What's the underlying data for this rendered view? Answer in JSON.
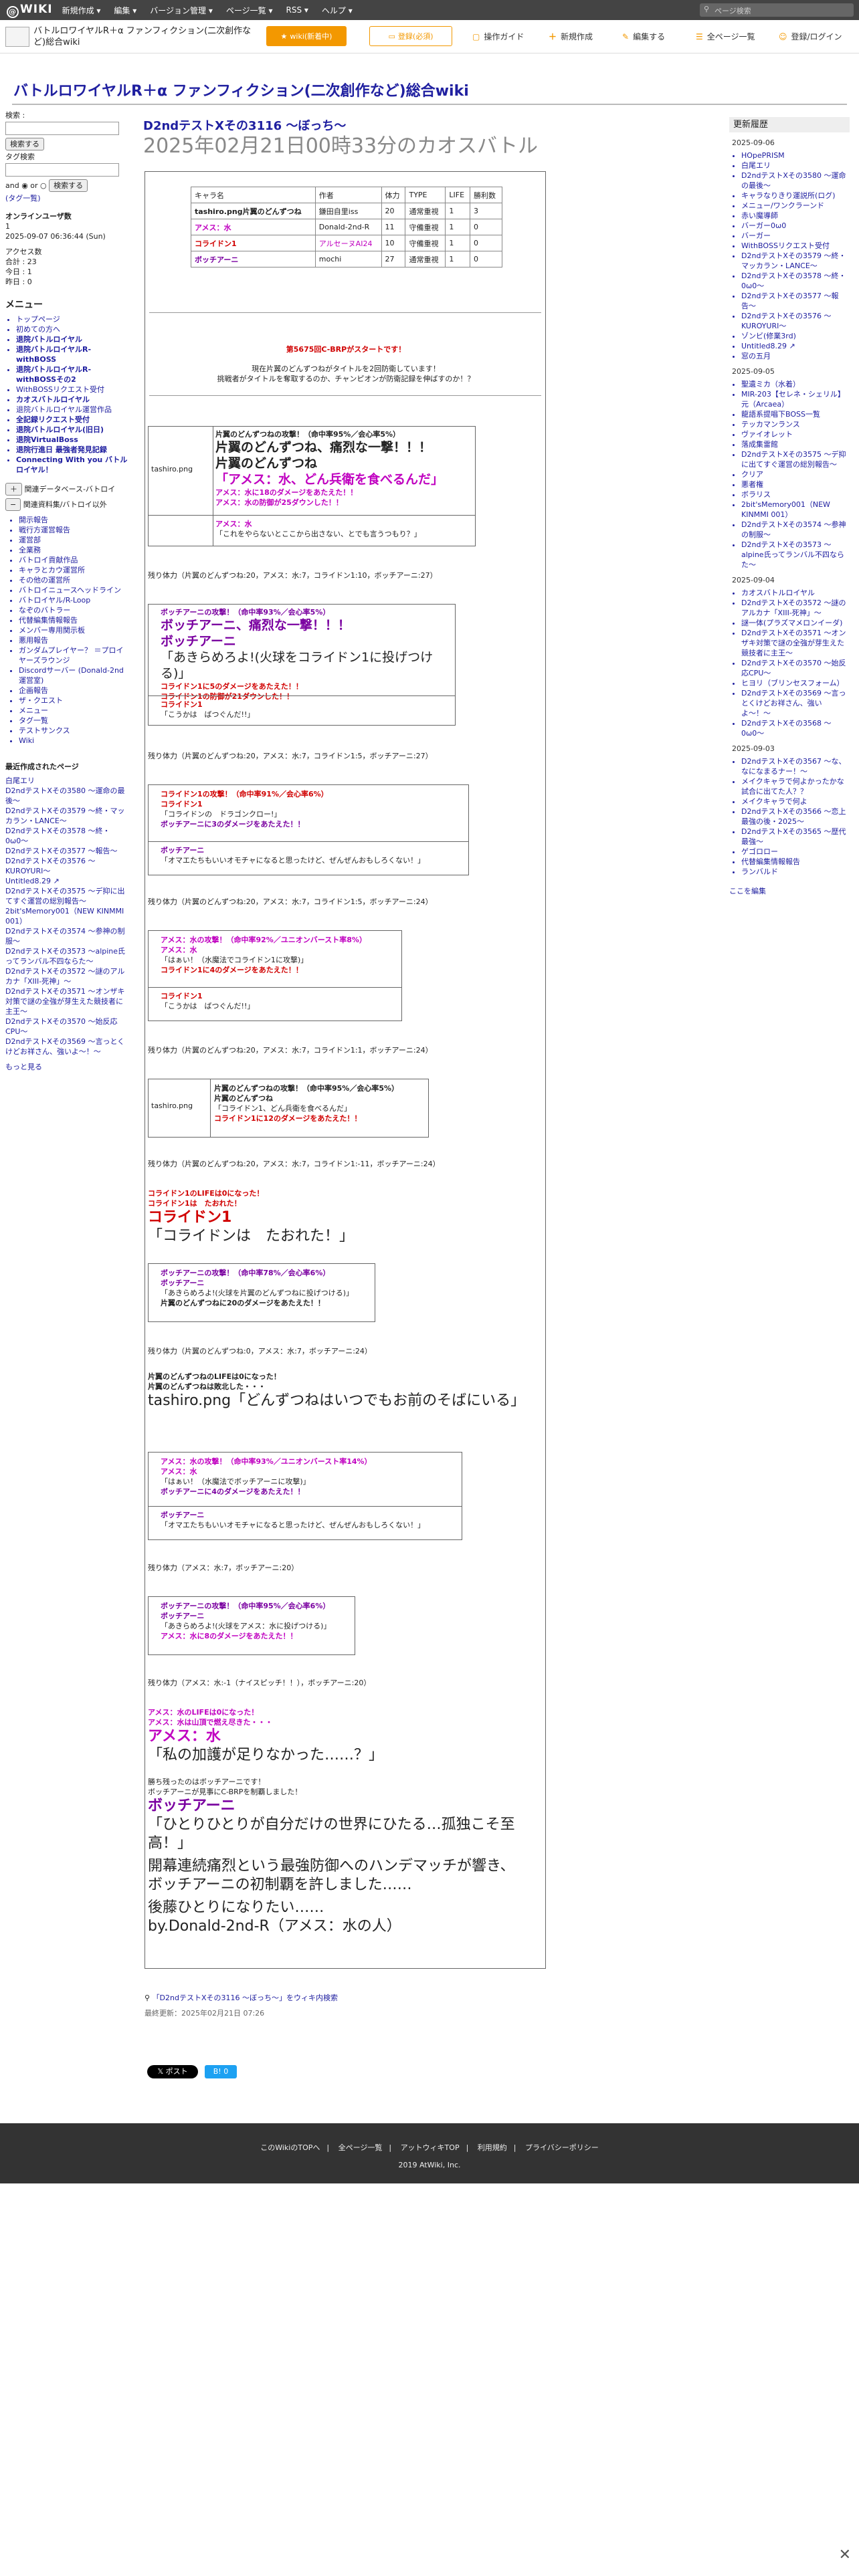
{
  "topbar": {
    "logo": "WIKI",
    "menus": [
      "新規作成 ▾",
      "編集 ▾",
      "バージョン管理 ▾",
      "ページ一覧 ▾",
      "RSS ▾",
      "ヘルプ ▾"
    ],
    "search_placeholder": "ページ検索"
  },
  "sitebar": {
    "title": "バトルロワイヤルR＋α ファンフィクション(二次創作など)総合wiki",
    "btn_wiki": "wiki(新着中)",
    "btn_register": "登録(必須)",
    "nav": [
      "操作ガイド",
      "新規作成",
      "編集する",
      "全ページ一覧",
      "登録/ログイン"
    ]
  },
  "h1": "バトルロワイヤルR＋α ファンフィクション(二次創作など)総合wiki",
  "left": {
    "search_label": "検索 :",
    "search_btn": "検索する",
    "tag_label": "タグ検索",
    "and_label": "and",
    "or_label": "or",
    "search_btn2": "検索する",
    "tag_list": "(タグ一覧)",
    "online_label": "オンラインユーザ数",
    "online_count": "1",
    "date": "2025-09-07 06:36:44 (Sun)",
    "access_label": "アクセス数",
    "access_total": "合計 : 23",
    "access_today": "今日 : 1",
    "access_yesterday": "昨日 : 0",
    "menu_head": "メニュー",
    "menu": [
      "トップページ",
      "初めての方へ",
      "退院バトルロイヤル",
      "退院バトルロイヤルR-withBOSS",
      "退院バトルロイヤルR-withBOSSその2",
      "WithBOSSリクエスト受付",
      "カオスバトルロイヤル",
      "退院バトルロイヤル運営作品",
      "全記録リクエスト受付",
      "退院バトルロイヤル(旧日)",
      "退院VirtualBoss",
      "退院行進日 最強者発見記録",
      "Connecting With you バトルロイヤル！"
    ],
    "tree": [
      "関連データベース-バトロイ",
      "関連資料集/バトロイ以外",
      "開示報告",
      "戦行方運営報告",
      "運営部",
      "全業務",
      "バトロイ貢献作品",
      "キャラとカウ運営所",
      "その他の運営所",
      "バトロイニュースヘッドライン",
      "バトロイヤル/R-Loop",
      "なぞのバトラー",
      "代替編集情報報告",
      "メンバー専用関示板",
      "悪用報告",
      "ガンダムプレイヤー？ ＝プロイヤーズラウンジ",
      "Discordサーバー (Donald-2nd運営室)",
      "企画報告",
      "ザ・クエスト",
      "メニュー",
      "タグ一覧",
      "テストサンクス",
      "Wiki"
    ],
    "recent_head": "最近作成されたページ",
    "recent": [
      "白尾エリ",
      "D2ndテストXその3580 〜運命の最後〜",
      "D2ndテストXその3579 〜終・マッカラン・LANCE〜",
      "D2ndテストXその3578 〜終・0ω0〜",
      "D2ndテストXその3577 〜報告〜",
      "D2ndテストXその3576 〜KUROYURI〜",
      "Untitled8.29 ↗",
      "D2ndテストXその3575 〜デ抑に出てすぐ運営の総別報告〜",
      "2bit'sMemory001（NEW KINMMI 001）",
      "D2ndテストXその3574 〜参神の制服〜",
      "D2ndテストXその3573 〜alpine氏ってランバル不四ならた〜",
      "D2ndテストXその3572 〜謎のアルカナ「XIII-死神」〜",
      "D2ndテストXその3571 〜オンザキ対策で謎の全強が芽生えた競技者に主王〜",
      "D2ndテストXその3570 〜始反応CPU〜",
      "D2ndテストXその3569 〜言っとくけどお祥さん、強いよ〜！〜"
    ],
    "more": "もっと見る"
  },
  "right": {
    "head": "更新履歴",
    "dates": [
      "2025-09-06",
      "2025-09-05",
      "2025-09-04",
      "2025-09-03"
    ],
    "lists": [
      [
        "HOpePRISM",
        "白尾エリ",
        "D2ndテストXその3580 〜運命の最後〜",
        "キャラなりきり運説所(ログ)",
        "メニュー/ワンクラーンド",
        "赤い魔導師",
        "バーガー0ω0",
        "バーガー",
        "WithBOSSリクエスト受付",
        "D2ndテストXその3579 〜終・マッカラン・LANCE〜",
        "D2ndテストXその3578 〜終・0ω0〜",
        "D2ndテストXその3577 〜報告〜",
        "D2ndテストXその3576 〜KUROYURI〜",
        "ゾンビ(修業3rd)",
        "Untitled8.29 ↗",
        "窓の五月"
      ],
      [
        "聖遺ミカ（水着）",
        "MIR-203【セレネ・シェリル】元（Arcaea）",
        "龍語系提唱下BOSS一覧",
        "テッカマンランス",
        "ヴァイオレット",
        "落成集雷館",
        "D2ndテストXその3575 〜デ抑に出てすぐ運営の総別報告〜",
        "クリア",
        "悪者権",
        "ボラリス",
        "2bit'sMemory001（NEW KINMMI 001）",
        "D2ndテストXその3574 〜参神の制服〜",
        "D2ndテストXその3573 〜alpine氏ってランバル不四ならた〜"
      ],
      [
        "カオスバトルロイヤル",
        "D2ndテストXその3572 〜謎のアルカナ「XIII-死神」〜",
        "謎一体(プラズマメロンイーダ)",
        "D2ndテストXその3571 〜オンザキ対策で謎の全強が芽生えた競技者に主王〜",
        "D2ndテストXその3570 〜始反応CPU〜",
        "ヒヨリ（ブリンセスフォーム）",
        "D2ndテストXその3569 〜言っとくけどお祥さん、強いよ〜！〜",
        "D2ndテストXその3568 〜0ω0〜"
      ],
      [
        "D2ndテストXその3567 〜な、なになまるナー！〜",
        "メイクキャラで何よかったかな試合に出てた人？？",
        "メイクキャラで何よ",
        "D2ndテストXその3566 〜恋上最強の後・2025〜",
        "D2ndテストXその3565 〜歴代最強〜",
        "ゲゴロロー",
        "代替編集情報報告",
        "ランバルド"
      ]
    ],
    "edit": "ここを編集"
  },
  "main": {
    "title": "D2ndテストXその3116 〜ぼっち〜",
    "date": "2025年02月21日00時33分のカオスバトル",
    "table_head": [
      "キャラ名",
      "作者",
      "体力",
      "TYPE",
      "LIFE",
      "勝利数"
    ],
    "table_rows": [
      [
        "片翼のどんずつね",
        "鎌田自里iss",
        "20",
        "通常重視",
        "1",
        "3"
      ],
      [
        "アメス：水",
        "Donald-2nd-R",
        "11",
        "守備重視",
        "1",
        "0"
      ],
      [
        "コライドン1",
        "アルセーヌAI24",
        "10",
        "守備重視",
        "1",
        "0"
      ],
      [
        "ボッチアーニ",
        "mochi",
        "27",
        "通常重視",
        "1",
        "0"
      ]
    ],
    "img_alt": "tashiro.png",
    "intro1": "第5675回C-BRPがスタートです！",
    "intro2": "現在片翼のどんずつねがタイトルを2回防衛しています！",
    "intro3": "挑戦者がタイトルを奪取するのか、チャンピオンが防衛記録を伸ばすのか！？",
    "b1": [
      "片翼のどんずつねの攻撃！（命中率95%／会心率5%）",
      "片翼のどんずつね、痛烈な一撃！！！",
      "片翼のどんずつね",
      "「アメス：水、どん兵衛を食べるんだ」",
      "アメス：水に18のダメージをあたえた！！",
      "アメス：水の防御が25ダウンした！！",
      "アメス：水",
      "「これをやらないとここから出さない、とでも言うつもり？」"
    ],
    "r1": "残り体力（片翼のどんずつね:20，アメス：水:7，コライドン1:10，ボッチアーニ:27）",
    "b2": [
      "ボッチアーニの攻撃！（命中率93%／会心率5%）",
      "ボッチアーニ、痛烈な一撃！！！",
      "ボッチアーニ",
      "「あきらめろよ!(火球をコライドン1に投げつける)」",
      "コライドン1に5のダメージをあたえた！！",
      "コライドン1の防御が21ダウンした！！",
      "コライドン1",
      "「こうかは　ばつぐんだ!!」"
    ],
    "r2": "残り体力（片翼のどんずつね:20，アメス：水:7，コライドン1:5，ボッチアーニ:27）",
    "b3": [
      "コライドン1の攻撃！（命中率91%／会心率6%）",
      "コライドン1",
      "「コライドンの　ドラゴンクロー!」",
      "ボッチアーニに3のダメージをあたえた！！",
      "ボッチアーニ",
      "「オマエたちもいいオモチャになると思ったけど、ぜんぜんおもしろくない！」"
    ],
    "r3": "残り体力（片翼のどんずつね:20，アメス：水:7，コライドン1:5，ボッチアーニ:24）",
    "b4": [
      "アメス：水の攻撃！（命中率92%／ユニオンバースト率8%）",
      "アメス：水",
      "「はぁい！（水魔法でコライドン1に攻撃)」",
      "コライドン1に4のダメージをあたえた！！",
      "コライドン1",
      "「こうかは　ばつぐんだ!!」"
    ],
    "r4": "残り体力（片翼のどんずつね:20，アメス：水:7，コライドン1:1，ボッチアーニ:24）",
    "b5": [
      "片翼のどんずつねの攻撃！（命中率95%／会心率5%）",
      "片翼のどんずつね",
      "「コライドン1、どん兵衛を食べるんだ」",
      "コライドン1に12のダメージをあたえた！！"
    ],
    "r5": "残り体力（片翼のどんずつね:20，アメス：水:7，コライドン1:-11，ボッチアーニ:24）",
    "k1": [
      "コライドン1のLIFEは0になった！",
      "コライドン1は　たおれた！",
      "コライドン1",
      "「コライドンは　たおれた！」"
    ],
    "b6": [
      "ボッチアーニの攻撃！（命中率78%／会心率6%）",
      "ボッチアーニ",
      "「あきらめろよ!(火球を片翼のどんずつねに投げつける)」",
      "片翼のどんずつねに20のダメージをあたえた！！"
    ],
    "r6": "残り体力（片翼のどんずつね:0，アメス：水:7，ボッチアーニ:24）",
    "k2": [
      "片翼のどんずつねのLIFEは0になった！",
      "片翼のどんずつねは敗北した・・・",
      "tashiro.png「どんずつねはいつでもお前のそばにいる」"
    ],
    "b7": [
      "アメス：水の攻撃！（命中率93%／ユニオンバースト率14%）",
      "アメス：水",
      "「はぁい！（水魔法でボッチアーニに攻撃)」",
      "ボッチアーニに4のダメージをあたえた！！",
      "ボッチアーニ",
      "「オマエたちもいいオモチャになると思ったけど、ぜんぜんおもしろくない！」"
    ],
    "r7": "残り体力（アメス：水:7，ボッチアーニ:20）",
    "b8": [
      "ボッチアーニの攻撃！（命中率95%／会心率6%）",
      "ボッチアーニ",
      "「あきらめろよ!(火球をアメス：水に投げつける)」",
      "アメス：水に8のダメージをあたえた！！"
    ],
    "r8": "残り体力（アメス：水:-1（ナイスピッチ！！），ボッチアーニ:20）",
    "k3": [
      "アメス：水のLIFEは0になった！",
      "アメス：水は山頂で燃え尽きた・・・",
      "アメス：水",
      "「私の加護が足りなかった……？」"
    ],
    "end": [
      "勝ち残ったのはボッチアーニです！",
      "ボッチアーニが見事にC-BRPを制覇しました！",
      "ボッチアーニ",
      "「ひとりひとりが自分だけの世界にひたる…孤独こそ至高！」",
      "開幕連続痛烈という最強防御へのハンデマッチが響き、",
      "ボッチアーニの初制覇を許しました……",
      "後藤ひとりになりたい……",
      "by.Donald-2nd-R（アメス：水の人）"
    ],
    "wiki_link": "「D2ndテストXその3116 〜ぼっち〜」をウィキ内検索",
    "last_updated": "最終更新：2025年02月21日 07:26",
    "share_x": "𝕏 ポスト",
    "share_b": "B! 0"
  },
  "footer": {
    "links": [
      "このWikiのTOPへ",
      "全ページ一覧",
      "アットウィキTOP",
      "利用規約",
      "プライバシーポリシー"
    ],
    "copy": "2019 AtWiki, Inc."
  },
  "colors": {
    "link": "#2020a0",
    "accent": "#f39800",
    "pink": "#c000c0",
    "red": "#d00000"
  }
}
